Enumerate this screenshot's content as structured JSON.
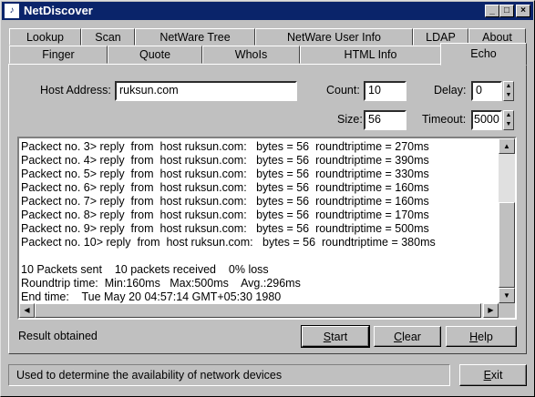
{
  "window": {
    "title": "NetDiscover",
    "icon_glyph": "♪",
    "controls": {
      "minimize": "_",
      "maximize": "□",
      "close": "×"
    }
  },
  "tabs": {
    "row1": [
      "Lookup",
      "Scan",
      "NetWare Tree",
      "NetWare User Info",
      "LDAP",
      "About"
    ],
    "row2": [
      "Finger",
      "Quote",
      "WhoIs",
      "HTML Info"
    ],
    "active": "Echo"
  },
  "form": {
    "host_label": "Host Address:",
    "host_value": "ruksun.com",
    "count_label": "Count:",
    "count_value": "10",
    "delay_label": "Delay:",
    "delay_value": "0",
    "size_label": "Size:",
    "size_value": "56",
    "timeout_label": "Timeout:",
    "timeout_value": "5000"
  },
  "output": {
    "lines": [
      "Packect no. 3> reply  from  host ruksun.com:   bytes = 56  roundtriptime = 270ms",
      "Packect no. 4> reply  from  host ruksun.com:   bytes = 56  roundtriptime = 390ms",
      "Packect no. 5> reply  from  host ruksun.com:   bytes = 56  roundtriptime = 330ms",
      "Packect no. 6> reply  from  host ruksun.com:   bytes = 56  roundtriptime = 160ms",
      "Packect no. 7> reply  from  host ruksun.com:   bytes = 56  roundtriptime = 160ms",
      "Packect no. 8> reply  from  host ruksun.com:   bytes = 56  roundtriptime = 170ms",
      "Packect no. 9> reply  from  host ruksun.com:   bytes = 56  roundtriptime = 500ms",
      "Packect no. 10> reply  from  host ruksun.com:   bytes = 56  roundtriptime = 380ms",
      "",
      "10 Packets sent    10 packets received    0% loss",
      "Roundtrip time:  Min:160ms   Max:500ms    Avg.:296ms",
      "End time:    Tue May 20 04:57:14 GMT+05:30 1980"
    ]
  },
  "result_text": "Result obtained",
  "buttons": {
    "start": {
      "first": "S",
      "rest": "tart"
    },
    "clear": {
      "first": "C",
      "rest": "lear"
    },
    "help": {
      "first": "H",
      "rest": "elp"
    },
    "exit": {
      "first": "E",
      "rest": "xit"
    }
  },
  "status_text": "Used to determine the availability of network devices"
}
